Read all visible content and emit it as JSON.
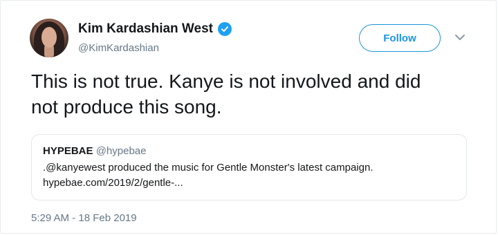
{
  "author": {
    "display_name": "Kim Kardashian West",
    "handle": "@KimKardashian",
    "verified": true
  },
  "follow_button": {
    "label": "Follow"
  },
  "tweet": {
    "text_line1": "This is not true. Kanye is not involved and did",
    "text_line2": "not produce this song."
  },
  "quoted_tweet": {
    "name": "HYPEBAE",
    "handle": "@hypebae",
    "text": ".@kanyewest produced the music for Gentle Monster's latest campaign.",
    "link": "hypebae.com/2019/2/gentle-..."
  },
  "timestamp": "5:29 AM - 18 Feb 2019",
  "colors": {
    "accent": "#1b95e0",
    "verified": "#1da1f2",
    "secondary_text": "#657786",
    "border": "#e1e8ed"
  },
  "icons": {
    "verified": "verified-badge-icon",
    "caret": "chevron-down-icon"
  }
}
